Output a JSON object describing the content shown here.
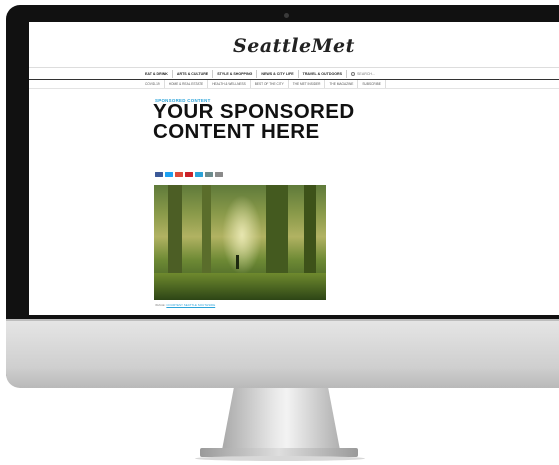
{
  "site": {
    "logo": "SeattleMet",
    "nav_main": [
      "EAT & DRINK",
      "ARTS & CULTURE",
      "STYLE & SHOPPING",
      "NEWS & CITY LIFE",
      "TRAVEL & OUTDOORS"
    ],
    "search_placeholder": "SEARCH...",
    "nav_sub": [
      "COVID-19",
      "HOME & REAL ESTATE",
      "HEALTH & WELLNESS",
      "BEST OF THE CITY",
      "THE MET INSIDER",
      "THE MAGAZINE",
      "SUBSCRIBE"
    ]
  },
  "article": {
    "kicker": "SPONSORED CONTENT",
    "headline_line1": "YOUR SPONSORED",
    "headline_line2": "CONTENT HERE",
    "share_buttons": [
      {
        "icon": "facebook-icon",
        "color": "#3b5998"
      },
      {
        "icon": "twitter-icon",
        "color": "#1da1f2"
      },
      {
        "icon": "google-plus-icon",
        "color": "#dd4b39"
      },
      {
        "icon": "pinterest-icon",
        "color": "#cb2027"
      },
      {
        "icon": "email-icon",
        "color": "#2aa3d9"
      },
      {
        "icon": "print-icon",
        "color": "#6d8b8c"
      },
      {
        "icon": "more-icon",
        "color": "#8a8a8a"
      }
    ],
    "photo_caption_prefix": "IMAGE:",
    "photo_caption_link": "COURTESY SEATTLE SOUTHSIDE"
  }
}
